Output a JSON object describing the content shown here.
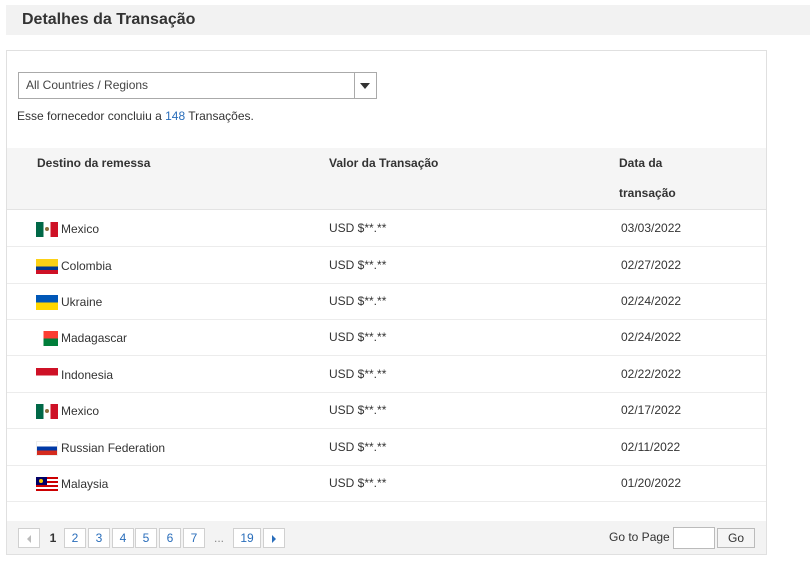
{
  "header": {
    "title": "Detalhes da Transação"
  },
  "filter": {
    "selected": "All Countries / Regions"
  },
  "summary": {
    "prefix": "Esse fornecedor concluiu a",
    "count": "148",
    "suffix": "Transações."
  },
  "table": {
    "headers": {
      "destination": "Destino da remessa",
      "value": "Valor da Transação",
      "date_line1": "Data da",
      "date_line2": "transação"
    },
    "rows": [
      {
        "country": "Mexico",
        "flag": "mexico-flag-icon",
        "value": "USD $**.**",
        "date": "03/03/2022"
      },
      {
        "country": "Colombia",
        "flag": "colombia-flag-icon",
        "value": "USD $**.**",
        "date": "02/27/2022"
      },
      {
        "country": "Ukraine",
        "flag": "ukraine-flag-icon",
        "value": "USD $**.**",
        "date": "02/24/2022"
      },
      {
        "country": "Madagascar",
        "flag": "madagascar-flag-icon",
        "value": "USD $**.**",
        "date": "02/24/2022"
      },
      {
        "country": "Indonesia",
        "flag": "indonesia-flag-icon",
        "value": "USD $**.**",
        "date": "02/22/2022"
      },
      {
        "country": "Mexico",
        "flag": "mexico-flag-icon",
        "value": "USD $**.**",
        "date": "02/17/2022"
      },
      {
        "country": "Russian Federation",
        "flag": "russia-flag-icon",
        "value": "USD $**.**",
        "date": "02/11/2022"
      },
      {
        "country": "Malaysia",
        "flag": "malaysia-flag-icon",
        "value": "USD $**.**",
        "date": "01/20/2022"
      }
    ]
  },
  "pagination": {
    "current": "1",
    "pages": [
      "2",
      "3",
      "4",
      "5",
      "6",
      "7"
    ],
    "ellipsis": "...",
    "last": "19",
    "goto_label": "Go to Page",
    "go_button": "Go"
  },
  "colors": {
    "link": "#2a6ebb",
    "header_bg": "#f2f2f2",
    "table_head_bg": "#f5f5f5"
  }
}
